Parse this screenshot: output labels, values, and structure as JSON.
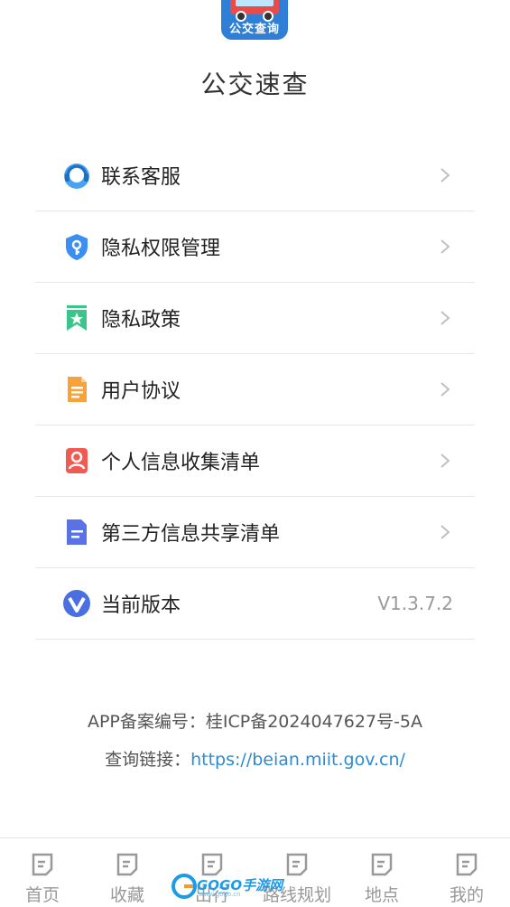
{
  "app": {
    "icon_label": "公交查询",
    "name": "公交速查"
  },
  "menu": [
    {
      "label": "联系客服",
      "icon": "customer-service-headset-icon"
    },
    {
      "label": "隐私权限管理",
      "icon": "shield-key-icon"
    },
    {
      "label": "隐私政策",
      "icon": "bookmark-star-icon"
    },
    {
      "label": "用户协议",
      "icon": "document-icon"
    },
    {
      "label": "个人信息收集清单",
      "icon": "person-card-icon"
    },
    {
      "label": "第三方信息共享清单",
      "icon": "list-document-icon"
    },
    {
      "label": "当前版本",
      "icon": "v-logo-icon",
      "value": "V1.3.7.2"
    }
  ],
  "footer": {
    "filing": "APP备案编号：桂ICP备2024047627号-5A",
    "query_prefix": "查询链接：",
    "query_link": "https://beian.miit.gov.cn/"
  },
  "tabbar": {
    "tabs": [
      {
        "label": "首页"
      },
      {
        "label": "收藏"
      },
      {
        "label": "出行"
      },
      {
        "label": "路线规划"
      },
      {
        "label": "地点"
      },
      {
        "label": "我的"
      }
    ]
  },
  "watermark": {
    "text": "GOGO手游网",
    "sub": "www.gogo.cn"
  },
  "colors": {
    "accent": "#2d8bd6",
    "chevron": "#c0c0c0",
    "tab_text": "#999999"
  }
}
